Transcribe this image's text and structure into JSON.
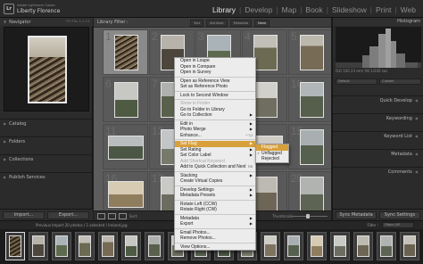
{
  "app": {
    "badge": "Lr",
    "name": "Adobe Lightroom Classic",
    "catalog": "Liberty Florence"
  },
  "modules": [
    {
      "label": "Library",
      "active": true
    },
    {
      "label": "Develop",
      "active": false
    },
    {
      "label": "Map",
      "active": false
    },
    {
      "label": "Book",
      "active": false
    },
    {
      "label": "Slideshow",
      "active": false
    },
    {
      "label": "Print",
      "active": false
    },
    {
      "label": "Web",
      "active": false
    }
  ],
  "left_panel": {
    "navigator_title": "Navigator",
    "navigator_options": "FIT  FILL  1:1  3:1",
    "sections": [
      "Catalog",
      "Folders",
      "Collections",
      "Publish Services"
    ],
    "import_label": "Import...",
    "export_label": "Export..."
  },
  "right_panel": {
    "histogram_title": "Histogram",
    "histogram_info": "ISO 100   23 mm   f/8   1/200 sec",
    "preset_left": "Default",
    "preset_right": "Custom",
    "sections": [
      "Quick Develop",
      "Keywording",
      "Keyword List",
      "Metadata",
      "Comments"
    ],
    "sync_metadata_label": "Sync Metadata",
    "sync_settings_label": "Sync Settings"
  },
  "grid": {
    "filter_title": "Library Filter :",
    "filter_tabs": [
      "Text",
      "Attribute",
      "Metadata",
      "None"
    ],
    "active_filter": "None",
    "cell_numbers": [
      "1",
      "2",
      "3",
      "4",
      "5",
      "6",
      "7",
      "8",
      "9",
      "10",
      "11",
      "12",
      "13",
      "14",
      "15",
      "16",
      "17",
      "18",
      "19",
      "20"
    ]
  },
  "toolbar": {
    "sort_label": "Sort:",
    "thumbnails_label": "Thumbnails"
  },
  "filmstrip_bar": {
    "info": "Previous Import    20 photos / 1 selected / Ireland.jpg",
    "filter_label": "Filter :",
    "filter_value": "Filters Off"
  },
  "context_menu": {
    "items": [
      {
        "label": "Open in Loupe"
      },
      {
        "label": "Open in Compare"
      },
      {
        "label": "Open in Survey"
      },
      {
        "sep": true
      },
      {
        "label": "Open as Reference View"
      },
      {
        "label": "Set as Reference Photo"
      },
      {
        "sep": true
      },
      {
        "label": "Lock to Second Window"
      },
      {
        "sep": true
      },
      {
        "label": "Show in Finder",
        "disabled": true
      },
      {
        "label": "Go to Folder in Library"
      },
      {
        "label": "Go to Collection",
        "arrow": true
      },
      {
        "sep": true
      },
      {
        "label": "Edit in",
        "arrow": true
      },
      {
        "label": "Photo Merge",
        "arrow": true
      },
      {
        "label": "Enhance...",
        "shortcut": "^⌥I"
      },
      {
        "sep": true
      },
      {
        "label": "Set Flag",
        "arrow": true,
        "highlighted": true
      },
      {
        "label": "Set Rating",
        "arrow": true
      },
      {
        "label": "Set Color Label",
        "arrow": true
      },
      {
        "label": "Add Shortcut Keyword",
        "disabled": true
      },
      {
        "label": "Add to Quick Collection and Next",
        "shortcut": "⇧B"
      },
      {
        "sep": true
      },
      {
        "label": "Stacking",
        "arrow": true
      },
      {
        "label": "Create Virtual Copies"
      },
      {
        "sep": true
      },
      {
        "label": "Develop Settings",
        "arrow": true
      },
      {
        "label": "Metadata Presets",
        "arrow": true
      },
      {
        "sep": true
      },
      {
        "label": "Rotate Left (CCW)"
      },
      {
        "label": "Rotate Right (CW)"
      },
      {
        "sep": true
      },
      {
        "label": "Metadata",
        "arrow": true
      },
      {
        "label": "Export",
        "arrow": true
      },
      {
        "sep": true
      },
      {
        "label": "Email Photos..."
      },
      {
        "label": "Remove Photos..."
      },
      {
        "sep": true
      },
      {
        "label": "View Options..."
      }
    ]
  },
  "flag_submenu": {
    "items": [
      {
        "label": "Flagged",
        "highlighted": true
      },
      {
        "label": "Unflagged",
        "checked": true
      },
      {
        "label": "Rejected"
      }
    ]
  },
  "colors": {
    "menu_highlight": "#d8a03a",
    "active_module": "#e6e6e6",
    "grid_bg": "#5d5d5d"
  }
}
